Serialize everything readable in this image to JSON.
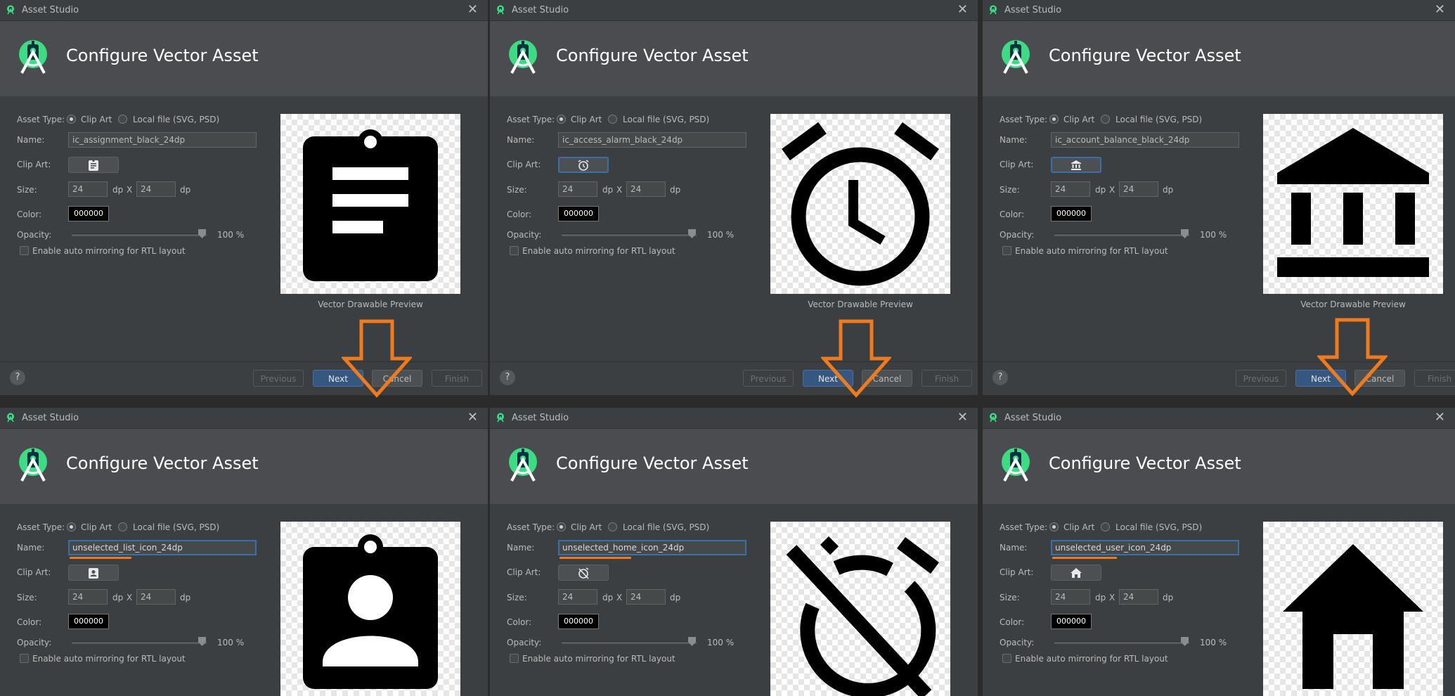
{
  "app": {
    "window_title": "Asset Studio",
    "heading": "Configure Vector Asset"
  },
  "form": {
    "asset_type_label": "Asset Type:",
    "clip_art_option": "Clip Art",
    "local_file_option": "Local file (SVG, PSD)",
    "name_label": "Name:",
    "clip_art_label": "Clip Art:",
    "size_label": "Size:",
    "dp": "dp",
    "x": "X",
    "color_label": "Color:",
    "opacity_label": "Opacity:",
    "rtl_label": "Enable auto mirroring for RTL layout",
    "percent": "%"
  },
  "preview_label": "Vector Drawable Preview",
  "buttons": {
    "previous": "Previous",
    "next": "Next",
    "cancel": "Cancel",
    "finish": "Finish",
    "help": "?"
  },
  "colors": {
    "arrow": "#f07a1e",
    "focus": "#3d6fa6",
    "primary": "#365880"
  },
  "dialogs": [
    {
      "name_value": "ic_assignment_black_24dp",
      "icon": "assignment-icon",
      "width": "24",
      "height": "24",
      "color": "000000",
      "opacity": "100",
      "focused": false
    },
    {
      "name_value": "ic_access_alarm_black_24dp",
      "icon": "alarm-icon",
      "width": "24",
      "height": "24",
      "color": "000000",
      "opacity": "100",
      "focused": false
    },
    {
      "name_value": "ic_account_balance_black_24dp",
      "icon": "bank-icon",
      "width": "24",
      "height": "24",
      "color": "000000",
      "opacity": "100",
      "focused": false
    },
    {
      "name_value": "unselected_list_icon_24dp",
      "icon": "assignment-ind-icon",
      "width": "24",
      "height": "24",
      "color": "000000",
      "opacity": "100",
      "focused": true
    },
    {
      "name_value": "unselected_home_icon_24dp",
      "icon": "alarm-off-icon",
      "width": "24",
      "height": "24",
      "color": "000000",
      "opacity": "100",
      "focused": true
    },
    {
      "name_value": "unselected_user_icon_24dp",
      "icon": "home-icon",
      "width": "24",
      "height": "24",
      "color": "000000",
      "opacity": "100",
      "focused": true
    }
  ]
}
